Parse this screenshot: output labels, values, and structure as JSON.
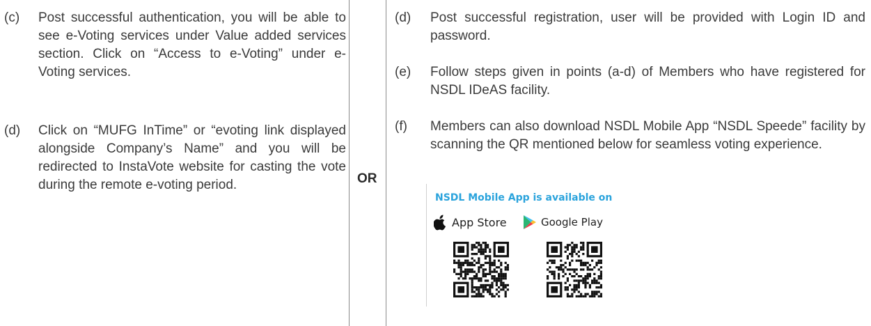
{
  "left": {
    "items": [
      {
        "marker": "(c)",
        "text": "Post successful authentication, you will be able to see e-Voting services under Value added services section. Click on “Access to e-Voting” under e-Voting services."
      },
      {
        "marker": "(d)",
        "text": "Click on “MUFG InTime” or “evoting link displayed alongside Company’s Name” and you will be redirected to InstaVote website for casting the vote during the remote e-voting period."
      }
    ]
  },
  "separator": {
    "label": "OR"
  },
  "right": {
    "items": [
      {
        "marker": "(d)",
        "text": "Post successful registration, user will be provided with Login ID and password."
      },
      {
        "marker": "(e)",
        "text": "Follow steps given in points (a-d) of Members who have registered for NSDL IDeAS facility."
      },
      {
        "marker": "(f)",
        "text": "Members can also download NSDL Mobile App “NSDL Speede” facility by scanning the QR mentioned below for seamless voting experience."
      }
    ]
  },
  "app_panel": {
    "heading": "NSDL Mobile App is available on",
    "heading_color": "#2aa3dc",
    "stores": [
      {
        "label": "App Store",
        "icon": "apple-icon"
      },
      {
        "label": "Google Play",
        "icon": "google-play-icon"
      }
    ]
  }
}
